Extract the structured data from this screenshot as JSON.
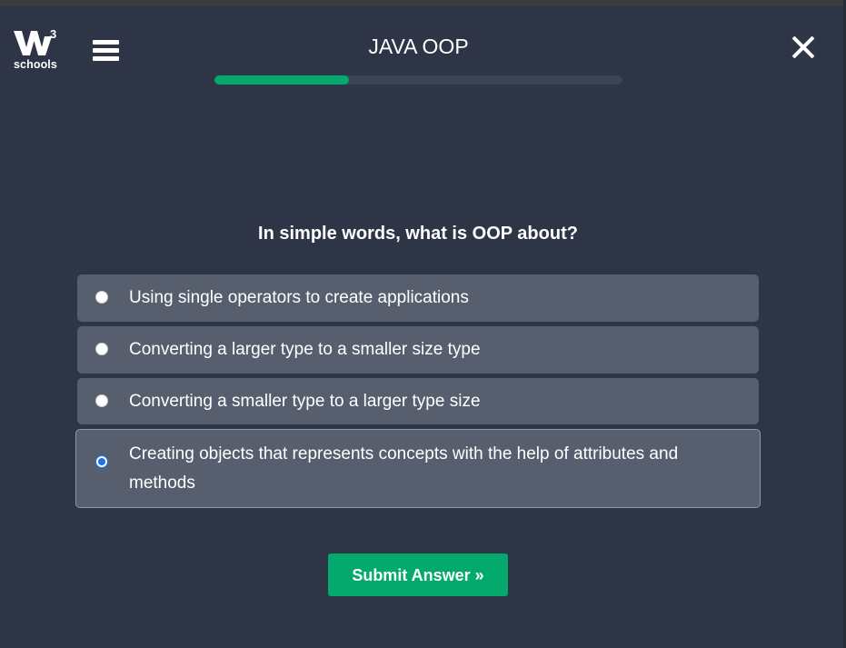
{
  "header": {
    "logo": {
      "superscript": "3",
      "text": "schools"
    },
    "menu_icon": "hamburger-menu-icon",
    "title": "JAVA OOP",
    "progress_fraction": 0.33,
    "close_icon": "close-icon"
  },
  "quiz": {
    "question": "In simple words, what is OOP about?",
    "options": [
      {
        "label": "Using single operators to create applications",
        "selected": false
      },
      {
        "label": "Converting a larger type to a smaller size type",
        "selected": false
      },
      {
        "label": "Converting a smaller type to a larger type size",
        "selected": false
      },
      {
        "label": "Creating objects that represents concepts with the help of attributes and methods",
        "selected": true
      }
    ],
    "submit_label": "Submit Answer »"
  },
  "colors": {
    "background": "#2d3546",
    "accent": "#04aa6d",
    "option_background": "#575f6e",
    "radio_selected": "#1a73e8"
  }
}
